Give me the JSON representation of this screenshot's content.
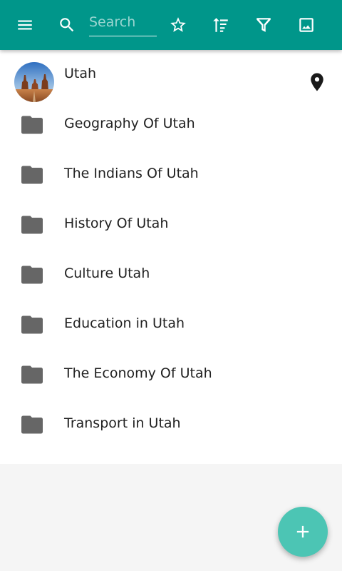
{
  "toolbar": {
    "menu_icon": "menu-icon",
    "search_icon": "search-icon",
    "search_placeholder": "Search",
    "search_value": "",
    "favorite_icon": "star-outline-icon",
    "sort_icon": "sort-icon",
    "filter_icon": "filter-icon",
    "image_icon": "image-icon",
    "color": "#00968a"
  },
  "location": {
    "title": "Utah",
    "avatar": "landscape-photo",
    "action_icon": "map-pin-icon"
  },
  "folders": [
    {
      "label": "Geography Of Utah",
      "icon": "folder-icon"
    },
    {
      "label": "The Indians Of Utah",
      "icon": "folder-icon"
    },
    {
      "label": "History Of Utah",
      "icon": "folder-icon"
    },
    {
      "label": "Culture Utah",
      "icon": "folder-icon"
    },
    {
      "label": "Education in Utah",
      "icon": "folder-icon"
    },
    {
      "label": "The Economy Of Utah",
      "icon": "folder-icon"
    },
    {
      "label": "Transport in Utah",
      "icon": "folder-icon"
    }
  ],
  "fab": {
    "icon": "plus-icon",
    "color": "#4cc5b4"
  }
}
